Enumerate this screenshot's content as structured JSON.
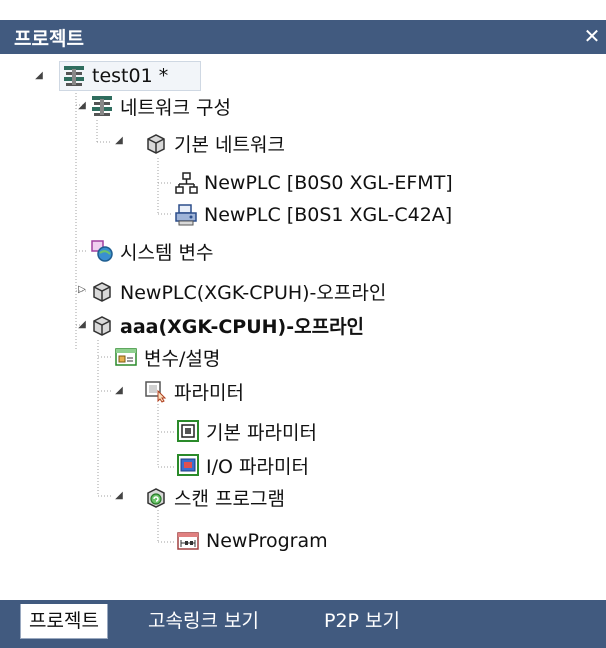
{
  "panel": {
    "title": "프로젝트",
    "close_glyph": "✕"
  },
  "tree": {
    "root": {
      "label": "test01 *",
      "icon": "project-icon"
    },
    "network_config": {
      "label": "네트워크 구성",
      "icon": "network-config-icon"
    },
    "basic_network": {
      "label": "기본 네트워크",
      "icon": "cube-icon"
    },
    "plc_b0s0": {
      "label": "NewPLC [B0S0 XGL-EFMT]",
      "icon": "network-module-icon"
    },
    "plc_b0s1": {
      "label": "NewPLC [B0S1 XGL-C42A]",
      "icon": "comm-module-icon"
    },
    "system_vars": {
      "label": "시스템 변수",
      "icon": "system-variable-icon"
    },
    "plc_offline": {
      "label": "NewPLC(XGK-CPUH)-오프라인",
      "icon": "cube-icon"
    },
    "aaa_offline": {
      "label": "aaa(XGK-CPUH)-오프라인",
      "icon": "cube-icon"
    },
    "var_desc": {
      "label": "변수/설명",
      "icon": "variable-icon"
    },
    "parameter": {
      "label": "파라미터",
      "icon": "parameter-icon"
    },
    "basic_param": {
      "label": "기본 파라미터",
      "icon": "basic-parameter-icon"
    },
    "io_param": {
      "label": "I/O 파라미터",
      "icon": "io-parameter-icon"
    },
    "scan_program": {
      "label": "스캔 프로그램",
      "icon": "scan-program-icon"
    },
    "new_program": {
      "label": "NewProgram",
      "icon": "program-icon"
    }
  },
  "tabs": [
    {
      "label": "프로젝트",
      "active": true
    },
    {
      "label": "고속링크 보기",
      "active": false
    },
    {
      "label": "P2P 보기",
      "active": false
    }
  ],
  "colors": {
    "header": "#415a7f",
    "tree_line": "#a0a0a0"
  }
}
